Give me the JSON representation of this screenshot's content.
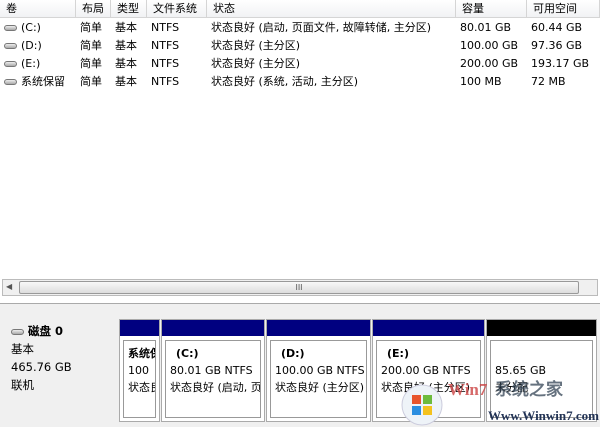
{
  "columns": [
    "卷",
    "布局",
    "类型",
    "文件系统",
    "状态",
    "容量",
    "可用空间"
  ],
  "volumes": [
    {
      "name": "(C:)",
      "layout": "简单",
      "type": "基本",
      "fs": "NTFS",
      "status": "状态良好 (启动, 页面文件, 故障转储, 主分区)",
      "capacity": "80.01 GB",
      "free": "60.44 GB"
    },
    {
      "name": "(D:)",
      "layout": "简单",
      "type": "基本",
      "fs": "NTFS",
      "status": "状态良好 (主分区)",
      "capacity": "100.00 GB",
      "free": "97.36 GB"
    },
    {
      "name": "(E:)",
      "layout": "简单",
      "type": "基本",
      "fs": "NTFS",
      "status": "状态良好 (主分区)",
      "capacity": "200.00 GB",
      "free": "193.17 GB"
    },
    {
      "name": "系统保留",
      "layout": "简单",
      "type": "基本",
      "fs": "NTFS",
      "status": "状态良好 (系统, 活动, 主分区)",
      "capacity": "100 MB",
      "free": "72 MB"
    }
  ],
  "scroll_thumb": "III",
  "disk": {
    "name": "磁盘 0",
    "type": "基本",
    "size": "465.76 GB",
    "state": "联机"
  },
  "partitions": [
    {
      "name": "系统保留",
      "size": "100",
      "status": "状态良好"
    },
    {
      "name": "(C:)",
      "size": "80.01 GB NTFS",
      "status": "状态良好 (启动, 页面文件)"
    },
    {
      "name": "(D:)",
      "size": "100.00 GB NTFS",
      "status": "状态良好 (主分区)"
    },
    {
      "name": "(E:)",
      "size": "200.00 GB NTFS",
      "status": "状态良好 (主分区)"
    },
    {
      "name": "",
      "size": "85.65 GB",
      "status": "未分配"
    }
  ],
  "watermark": {
    "brand": "Win7系统之家",
    "url": "Www.Winwin7.com"
  },
  "colors": {
    "primary": "#000080",
    "unallocated": "#000000"
  }
}
